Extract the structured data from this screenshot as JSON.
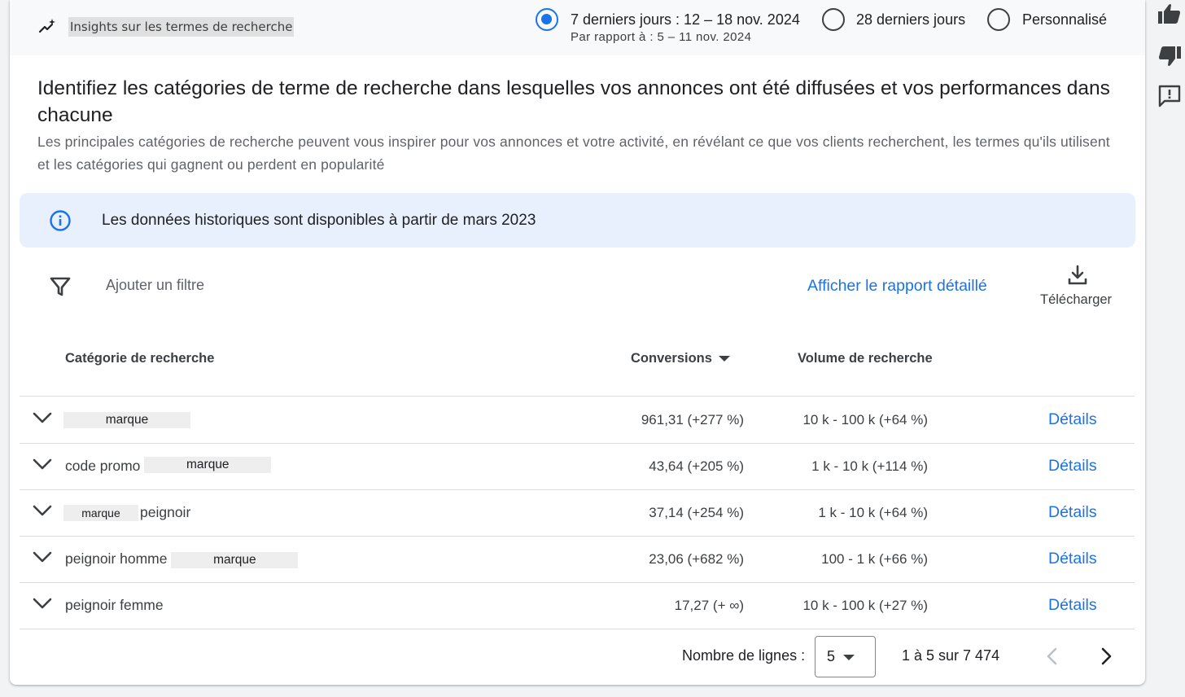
{
  "header": {
    "title": "Insights sur les termes de recherche",
    "periods": [
      {
        "label": "7 derniers jours : 12 – 18 nov. 2024",
        "sub": "Par rapport à : 5 – 11 nov. 2024",
        "selected": true
      },
      {
        "label": "28 derniers jours",
        "selected": false
      },
      {
        "label": "Personnalisé",
        "selected": false
      }
    ]
  },
  "intro": {
    "heading": "Identifiez les catégories de terme de recherche dans lesquelles vos annonces ont été diffusées et vos performances dans chacune",
    "description": "Les principales catégories de recherche peuvent vous inspirer pour vos annonces et votre activité, en révélant ce que vos clients recherchent, les termes qu'ils utilisent et les catégories qui gagnent ou perdent en popularité"
  },
  "banner": {
    "text": "Les données historiques sont disponibles à partir de mars 2023",
    "icon": "info-icon"
  },
  "toolbar": {
    "filter_placeholder": "Ajouter un filtre",
    "report_link": "Afficher le rapport détaillé",
    "download_label": "Télécharger"
  },
  "table": {
    "headers": {
      "category": "Catégorie de recherche",
      "conversions": "Conversions",
      "volume": "Volume de recherche"
    },
    "rows": [
      {
        "prefix": "",
        "mask": "marque",
        "suffix": "",
        "conversions": "961,31 (+277 %)",
        "volume": "10 k - 100 k (+64 %)",
        "details": "Détails"
      },
      {
        "prefix": "code promo ",
        "mask": "marque",
        "suffix": "",
        "conversions": "43,64 (+205 %)",
        "volume": "1 k - 10 k (+114 %)",
        "details": "Détails"
      },
      {
        "prefix": "",
        "mask": "marque",
        "suffix": "peignoir",
        "conversions": "37,14 (+254 %)",
        "volume": "1 k - 10 k (+64 %)",
        "details": "Détails"
      },
      {
        "prefix": "peignoir homme ",
        "mask": "marque",
        "suffix": "",
        "conversions": "23,06 (+682 %)",
        "volume": "100 - 1 k (+66 %)",
        "details": "Détails"
      },
      {
        "prefix": "peignoir femme",
        "mask": "",
        "suffix": "",
        "conversions": "17,27 (+ ∞)",
        "volume": "10 k - 100 k (+27 %)",
        "details": "Détails"
      }
    ]
  },
  "pagination": {
    "rows_label": "Nombre de lignes :",
    "rows_value": "5",
    "range": "1 à 5 sur 7 474"
  },
  "feedback": {
    "icons": [
      "thumbs-up-icon",
      "thumbs-down-icon",
      "feedback-icon"
    ]
  },
  "colors": {
    "accent": "#1a73e8",
    "banner_bg": "#e8f0fe",
    "text": "#3c4043"
  }
}
